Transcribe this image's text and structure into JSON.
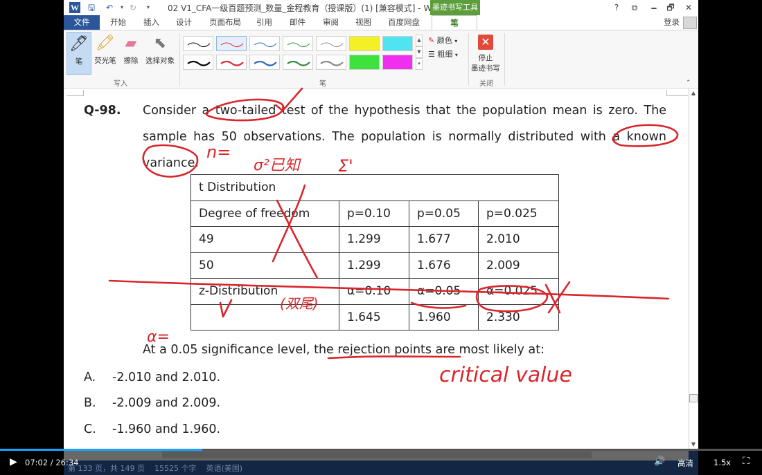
{
  "titlebar": {
    "doc_title": "02 V1_CFA一级百题预测_数量_金程教育（授课版）(1) [兼容模式] - Word",
    "context_tab": "墨迹书写工具",
    "help": "?",
    "minimize": "🗕",
    "restore": "🗗",
    "close": "✕",
    "ribbon_options": "⧉"
  },
  "tabs": {
    "file": "文件",
    "home": "开始",
    "insert": "插入",
    "design": "设计",
    "layout": "页面布局",
    "references": "引用",
    "mailings": "邮件",
    "review": "审阅",
    "view": "视图",
    "baidu": "百度网盘",
    "pen": "笔",
    "login": "登录"
  },
  "ribbon": {
    "pen": "笔",
    "highlighter": "荧光笔",
    "eraser": "擦除",
    "select_objects": "选择对象",
    "group_write": "写入",
    "group_pens": "笔",
    "group_close": "关闭",
    "color": "颜色",
    "thickness": "粗细",
    "stop_inking_1": "停止",
    "stop_inking_2": "墨迹书写"
  },
  "question": {
    "number": "Q-98.",
    "line1": "Consider a two-tailed test of the hypothesis that the population mean is zero. The",
    "line2": "sample has 50 observations. The population is normally distributed with a known",
    "line3": "variance."
  },
  "table": {
    "title": "t Distribution",
    "header": [
      "Degree of freedom",
      "p=0.10",
      "p=0.05",
      "p=0.025"
    ],
    "rows": [
      [
        "49",
        "1.299",
        "1.677",
        "2.010"
      ],
      [
        "50",
        "1.299",
        "1.676",
        "2.009"
      ],
      [
        "z-Distribution",
        "α=0.10",
        "α=0.05",
        "α=0.025"
      ],
      [
        "",
        "1.645",
        "1.960",
        "2.330"
      ]
    ]
  },
  "rejection_question": "At a 0.05 significance level, the rejection points are most likely at:",
  "options": [
    {
      "letter": "A.",
      "text": "-2.010 and 2.010."
    },
    {
      "letter": "B.",
      "text": "-2.009 and 2.009."
    },
    {
      "letter": "C.",
      "text": "-1.960 and 1.960."
    }
  ],
  "annotations": {
    "n_eq": "n=",
    "variance_known": "σ²已知",
    "sigma": "Σ'",
    "two_tailed": "(双尾)",
    "alpha_eq": "α=",
    "critical_value": "critical value",
    "ink_color": "#d9262b"
  },
  "statusbar": {
    "page": "第 133 页，共 149 页",
    "words": "15525 个字",
    "language": "英语(美国)"
  },
  "video": {
    "time": "07:02 / 26:34",
    "progress": 0.265,
    "quality": "高清",
    "speed": "1.5x"
  }
}
